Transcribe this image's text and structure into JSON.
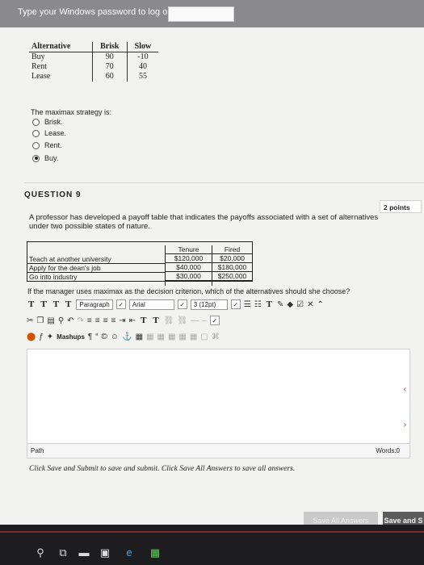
{
  "top_bar": {
    "label": "Type your Windows password to log on:"
  },
  "q8": {
    "table": {
      "headers": [
        "Alternative",
        "Brisk",
        "Slow"
      ],
      "rows": [
        [
          "Buy",
          "90",
          "-10"
        ],
        [
          "Rent",
          "70",
          "40"
        ],
        [
          "Lease",
          "60",
          "55"
        ]
      ]
    },
    "prompt": "The maximax strategy is:",
    "options": [
      {
        "label": "Brisk.",
        "selected": false
      },
      {
        "label": "Lease.",
        "selected": false
      },
      {
        "label": "Rent.",
        "selected": false
      },
      {
        "label": "Buy.",
        "selected": true
      }
    ]
  },
  "q9": {
    "heading": "QUESTION 9",
    "points": "2 points",
    "text": "A professor has developed a payoff table that indicates the payoffs associated with a set of alternatives under two possible states of nature.",
    "table": {
      "headers": [
        "Tenure",
        "Fired"
      ],
      "rows": [
        {
          "label": "Teach at another university",
          "tenure": "$120,000",
          "fired": "$20,000"
        },
        {
          "label": "Apply for the dean's job",
          "tenure": "$40,000",
          "fired": "$180,000"
        },
        {
          "label": "Go into industry",
          "tenure": "$30,000",
          "fired": "$250,000"
        }
      ]
    },
    "question": "If the manager uses maximax as the decision criterion, which of the alternatives should she choose?"
  },
  "editor": {
    "paragraph": "Paragraph",
    "font": "Arial",
    "size": "3 (12pt)",
    "mashups": "Mashups",
    "path_label": "Path",
    "words_label": "Words:0"
  },
  "instructions": "Click Save and Submit to save and submit. Click Save All Answers to save all answers.",
  "buttons": {
    "save_all": "Save All Answers",
    "save_submit": "Save and S"
  },
  "colors": {
    "page_bg": "#f2f2f0",
    "taskbar": "#1d1d1f",
    "save_submit_bg": "#5b5b5b"
  }
}
